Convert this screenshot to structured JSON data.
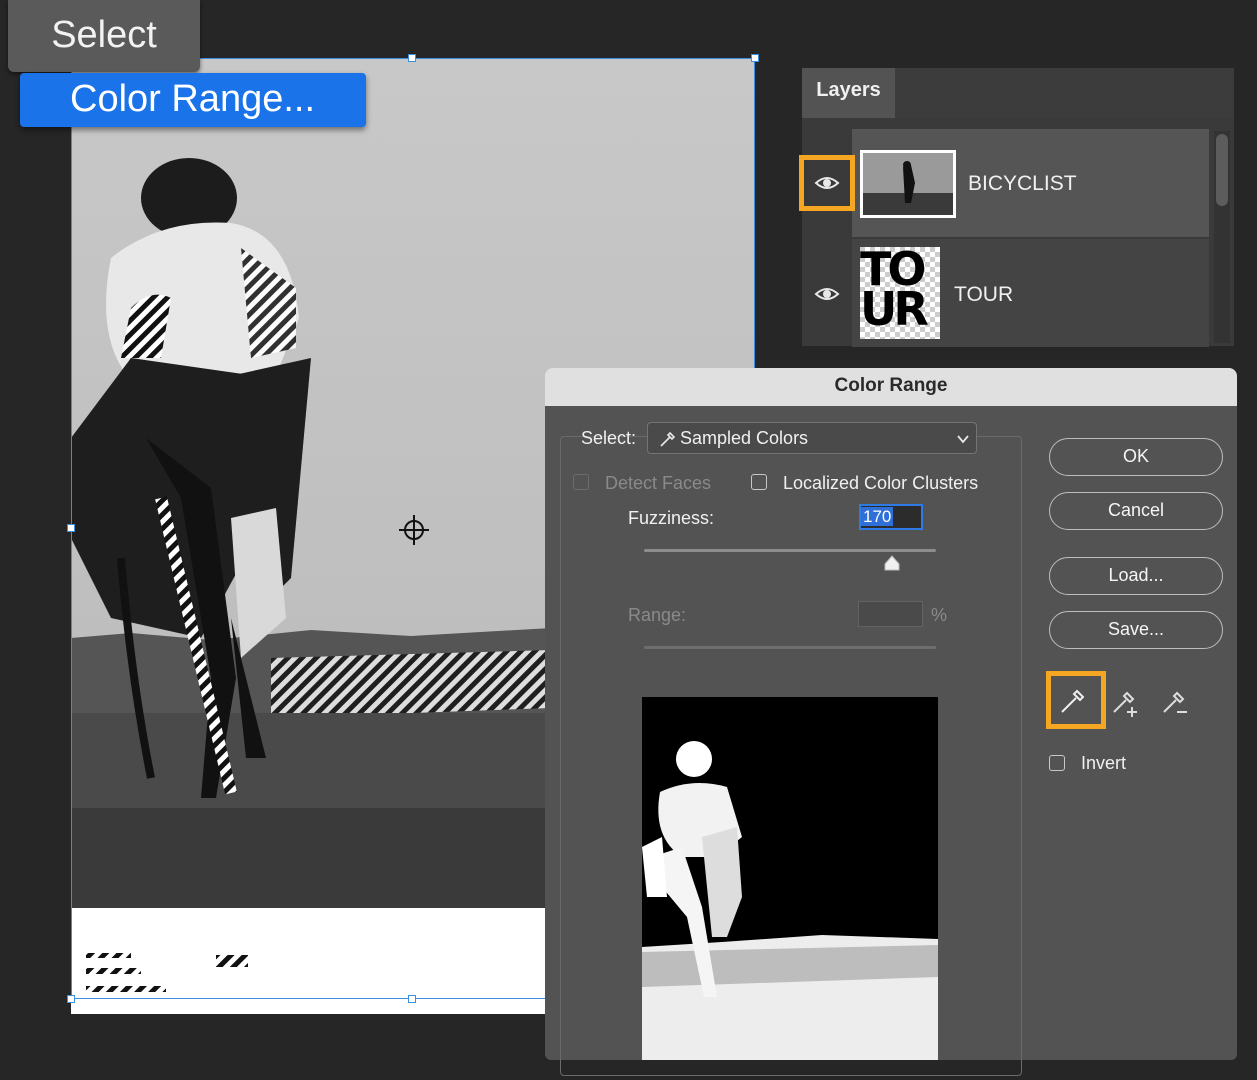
{
  "menu": {
    "select": "Select",
    "color_range_item": "Color Range..."
  },
  "layers_panel": {
    "tab": "Layers",
    "layers": [
      {
        "name": "BICYCLIST",
        "visible": true,
        "selected": true
      },
      {
        "name": "TOUR",
        "visible": true,
        "selected": false,
        "thumb_text_1": "TO",
        "thumb_text_2": "UR"
      }
    ]
  },
  "dialog": {
    "title": "Color Range",
    "select_label": "Select:",
    "select_value": "Sampled Colors",
    "detect_faces": {
      "label": "Detect Faces",
      "checked": false,
      "enabled": false
    },
    "localized_clusters": {
      "label": "Localized Color Clusters",
      "checked": false
    },
    "fuzziness_label": "Fuzziness:",
    "fuzziness_value": "170",
    "fuzziness_level": 0.85,
    "range_label": "Range:",
    "range_unit": "%",
    "buttons": {
      "ok": "OK",
      "cancel": "Cancel",
      "load": "Load...",
      "save": "Save..."
    },
    "tools": [
      "eyedropper-icon",
      "eyedropper-add-icon",
      "eyedropper-subtract-icon"
    ],
    "invert": {
      "label": "Invert",
      "checked": false
    }
  },
  "colors": {
    "highlight": "#f5a623",
    "accent": "#1a73e8"
  }
}
